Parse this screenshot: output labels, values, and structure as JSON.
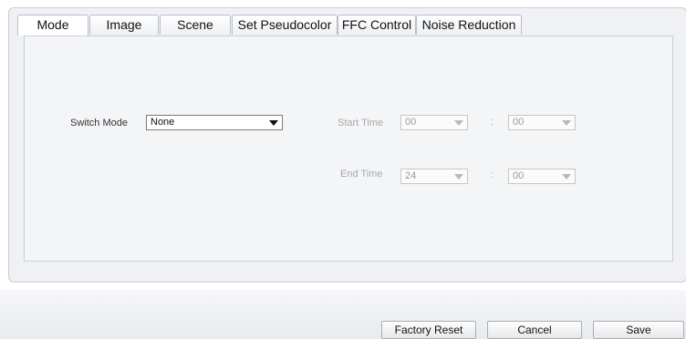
{
  "tabs": [
    {
      "label": "Mode"
    },
    {
      "label": "Image"
    },
    {
      "label": "Scene"
    },
    {
      "label": "Set Pseudocolor"
    },
    {
      "label": "FFC Control"
    },
    {
      "label": "Noise Reduction"
    }
  ],
  "active_tab": "Mode",
  "form": {
    "switch_mode": {
      "label": "Switch Mode",
      "value": "None"
    },
    "start_time": {
      "label": "Start Time",
      "hour": "00",
      "minute": "00",
      "separator": ":"
    },
    "end_time": {
      "label": "End Time",
      "hour": "24",
      "minute": "00",
      "separator": ":"
    }
  },
  "buttons": {
    "factory_reset": "Factory Reset",
    "cancel": "Cancel",
    "save": "Save"
  },
  "icons": {
    "dropdown": "triangle-down-icon"
  }
}
